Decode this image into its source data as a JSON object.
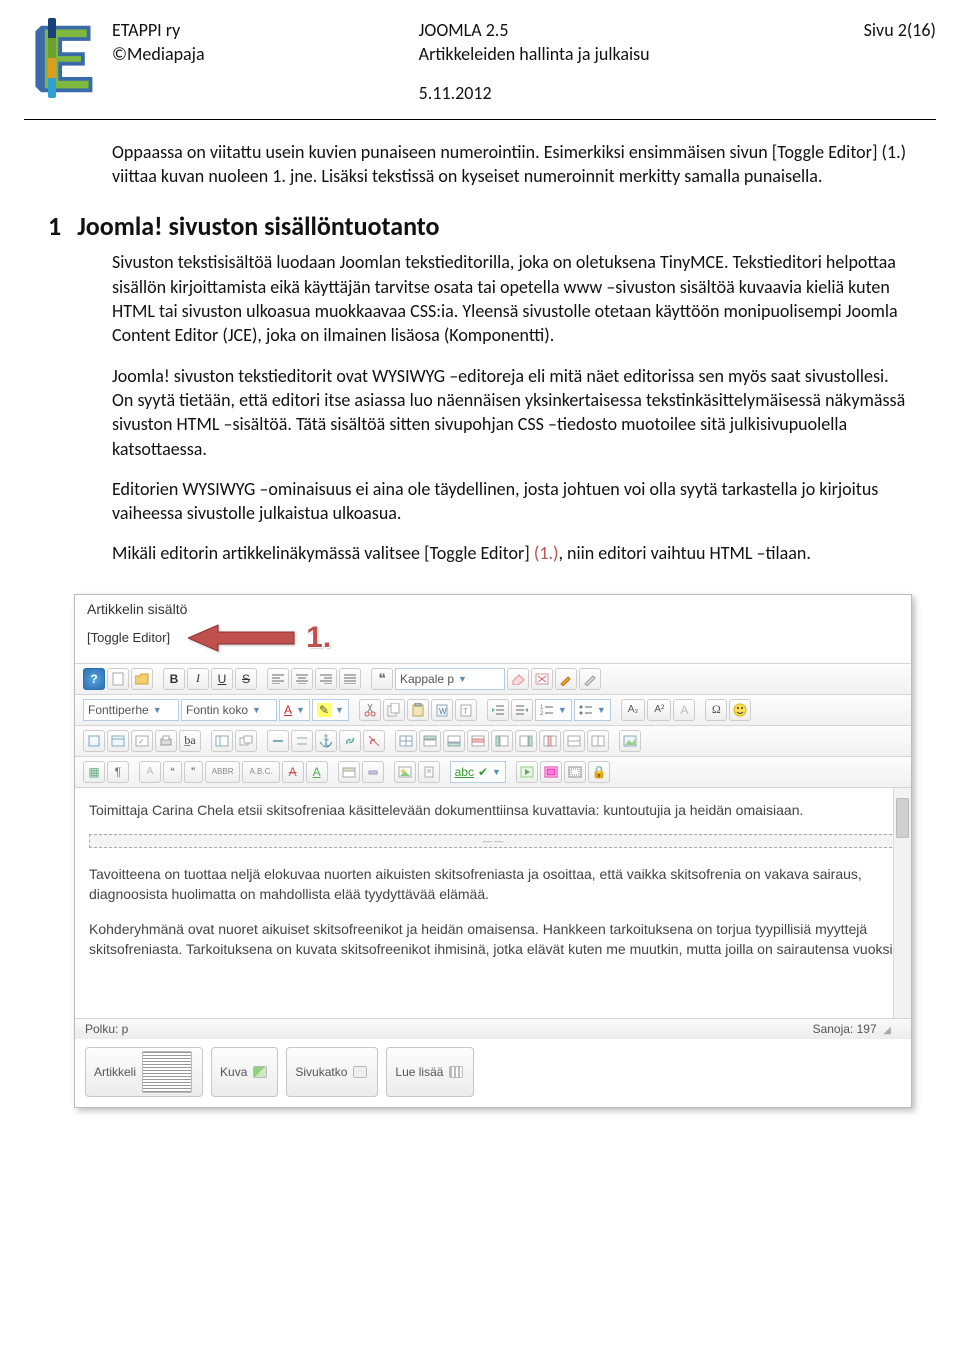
{
  "header": {
    "org": "ETAPPI ry",
    "copyright": "©Mediapaja",
    "center_title": "JOOMLA 2.5",
    "center_sub": "Artikkeleiden hallinta ja julkaisu",
    "date": "5.11.2012",
    "page": "Sivu 2(16)"
  },
  "intro": "Oppaassa on viitattu usein kuvien punaiseen numerointiin. Esimerkiksi ensimmäisen sivun [Toggle Editor] (1.) viittaa kuvan nuoleen 1. jne. Lisäksi tekstissä on kyseiset numeroinnit merkitty samalla punaisella.",
  "section": {
    "num": "1",
    "title": "Joomla! sivuston sisällöntuotanto"
  },
  "paragraphs": {
    "p1": "Sivuston tekstisisältöä luodaan Joomlan tekstieditorilla, joka on oletuksena TinyMCE. Tekstieditori helpottaa sisällön kirjoittamista eikä käyttäjän tarvitse osata tai opetella www –sivuston sisältöä kuvaavia kieliä kuten HTML tai sivuston ulkoasua muokkaavaa CSS:ia. Yleensä sivustolle otetaan käyttöön monipuolisempi Joomla Content Editor (JCE), joka on ilmainen lisäosa (Komponentti).",
    "p2": "Joomla! sivuston tekstieditorit ovat WYSIWYG –editoreja eli mitä näet editorissa sen myös saat sivustollesi. On syytä tietään, että editori itse asiassa luo näennäisen yksinkertaisessa tekstinkäsittelymäisessä näkymässä sivuston HTML –sisältöä. Tätä sisältöä sitten sivupohjan CSS –tiedosto muotoilee sitä julkisivupuolella katsottaessa.",
    "p3": "Editorien WYSIWYG –ominaisuus ei aina ole täydellinen, josta johtuen voi olla syytä tarkastella jo kirjoitus vaiheessa sivustolle julkaistua ulkoasua.",
    "p4_a": "Mikäli editorin artikkelinäkymässä valitsee [Toggle Editor] ",
    "p4_mark": "(1.)",
    "p4_b": ", niin editori vaihtuu HTML –tilaan."
  },
  "editor": {
    "panel_title": "Artikkelin sisältö",
    "toggle_label": "[Toggle Editor]",
    "callout": "1.",
    "font_family_label": "Fonttiperhe",
    "font_size_label": "Fontin koko",
    "paragraph_label": "Kappale p",
    "content_p1": "Toimittaja Carina Chela etsii skitsofreniaa käsittelevään dokumenttiinsa kuvattavia: kuntoutujia ja heidän omaisiaan.",
    "content_p2": "Tavoitteena on tuottaa neljä elokuvaa nuorten aikuisten skitsofreniasta ja osoittaa, että vaikka skitsofrenia on vakava sairaus, diagnoosista huolimatta on mahdollista elää tyydyttävää elämää.",
    "content_p3": "Kohderyhmänä ovat nuoret aikuiset skitsofreenikot ja heidän omaisensa. Hankkeen tarkoituksena on torjua tyypillisiä myyttejä skitsofreniasta. Tarkoituksena on kuvata skitsofreenikot ihmisinä, jotka elävät kuten me muutkin, mutta joilla on sairautensa vuoksi",
    "status_path": "Polku: p",
    "status_words": "Sanoja: 197",
    "btn_article": "Artikkeli",
    "btn_image": "Kuva",
    "btn_pagebreak": "Sivukatko",
    "btn_readmore": "Lue lisää"
  },
  "icons": {
    "help": "?",
    "bold": "B",
    "italic": "I",
    "underline": "U",
    "strike": "S",
    "a_letter": "A",
    "subscript": "A₂",
    "superscript": "A²",
    "omega": "Ω",
    "quote66": "❝",
    "quote99": "❞",
    "abbr": "ABBR",
    "abc": "A.B.C.",
    "spell": "abc",
    "para": "¶",
    "anchor": "⚓",
    "lock": "🔒",
    "grid": "▦",
    "ba": "b̲a"
  }
}
